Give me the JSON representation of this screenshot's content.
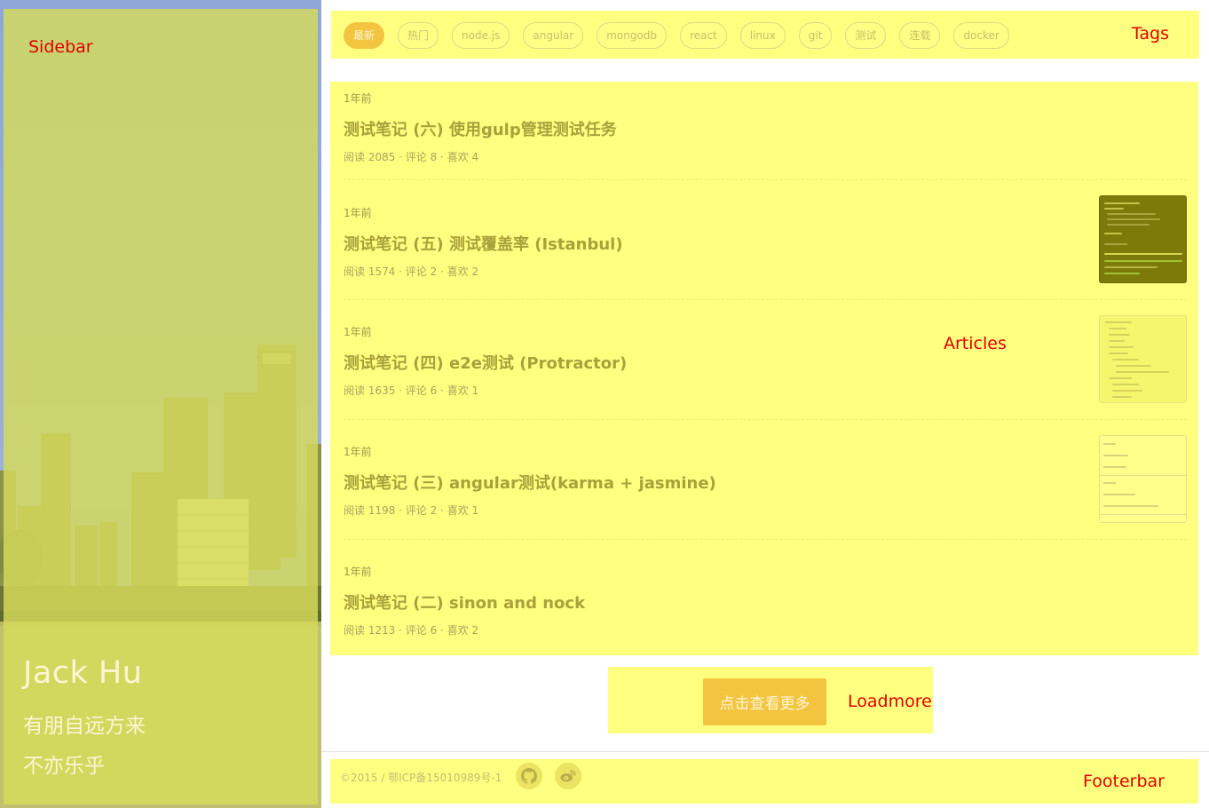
{
  "sidebar": {
    "label": "Sidebar",
    "author_name": "Jack Hu",
    "motto_line1": "有朋自远方来",
    "motto_line2": "不亦乐乎"
  },
  "tags": {
    "label": "Tags",
    "items": [
      {
        "label": "最新",
        "active": true
      },
      {
        "label": "热门",
        "active": false
      },
      {
        "label": "node.js",
        "active": false
      },
      {
        "label": "angular",
        "active": false
      },
      {
        "label": "mongodb",
        "active": false
      },
      {
        "label": "react",
        "active": false
      },
      {
        "label": "linux",
        "active": false
      },
      {
        "label": "git",
        "active": false
      },
      {
        "label": "测试",
        "active": false
      },
      {
        "label": "连载",
        "active": false
      },
      {
        "label": "docker",
        "active": false
      }
    ]
  },
  "articles": {
    "label": "Articles",
    "items": [
      {
        "time": "1年前",
        "title": "测试笔记 (六) 使用gulp管理测试任务",
        "meta": "阅读 2085 · 评论 8 · 喜欢 4",
        "thumb": "none"
      },
      {
        "time": "1年前",
        "title": "测试笔记 (五) 测试覆盖率 (Istanbul)",
        "meta": "阅读 1574 · 评论 2 · 喜欢 2",
        "thumb": "terminal-screenshot"
      },
      {
        "time": "1年前",
        "title": "测试笔记 (四) e2e测试 (Protractor)",
        "meta": "阅读 1635 · 评论 6 · 喜欢 1",
        "thumb": "file-tree-screenshot"
      },
      {
        "time": "1年前",
        "title": "测试笔记 (三) angular测试(karma + jasmine)",
        "meta": "阅读 1198 · 评论 2 · 喜欢 1",
        "thumb": "text-list-screenshot"
      },
      {
        "time": "1年前",
        "title": "测试笔记 (二) sinon and nock",
        "meta": "阅读 1213 · 评论 6 · 喜欢 2",
        "thumb": "none"
      }
    ]
  },
  "loadmore": {
    "label": "Loadmore",
    "button_label": "点击查看更多"
  },
  "footer": {
    "label": "Footerbar",
    "copyright": "©2015 / 鄂ICP备15010989号-1",
    "icons": [
      "github-icon",
      "weibo-icon"
    ]
  },
  "colors": {
    "highlight": "#ffff80",
    "accent": "#f2c440",
    "annotation_red": "#e00000"
  }
}
